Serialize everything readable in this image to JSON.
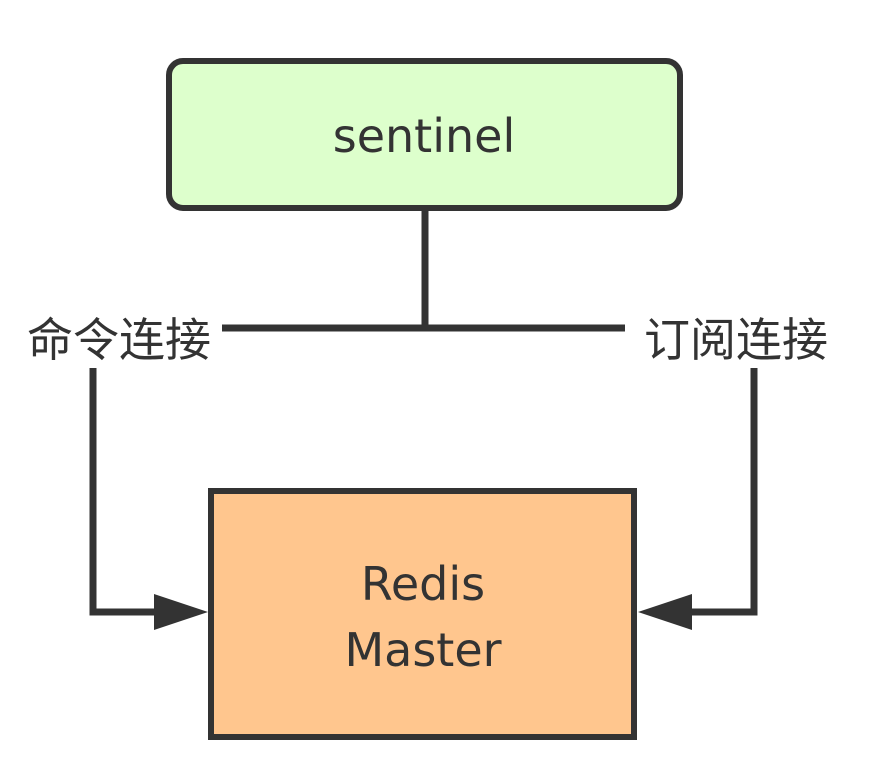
{
  "nodes": {
    "sentinel": {
      "label": "sentinel",
      "fill": "#DDFFCC",
      "stroke": "#333333"
    },
    "redis_master": {
      "label_line1": "Redis",
      "label_line2": "Master",
      "fill": "#FFC68E",
      "stroke": "#333333"
    }
  },
  "edges": {
    "command_connection": {
      "label": "命令连接"
    },
    "subscribe_connection": {
      "label": "订阅连接"
    }
  },
  "line_color": "#333333"
}
